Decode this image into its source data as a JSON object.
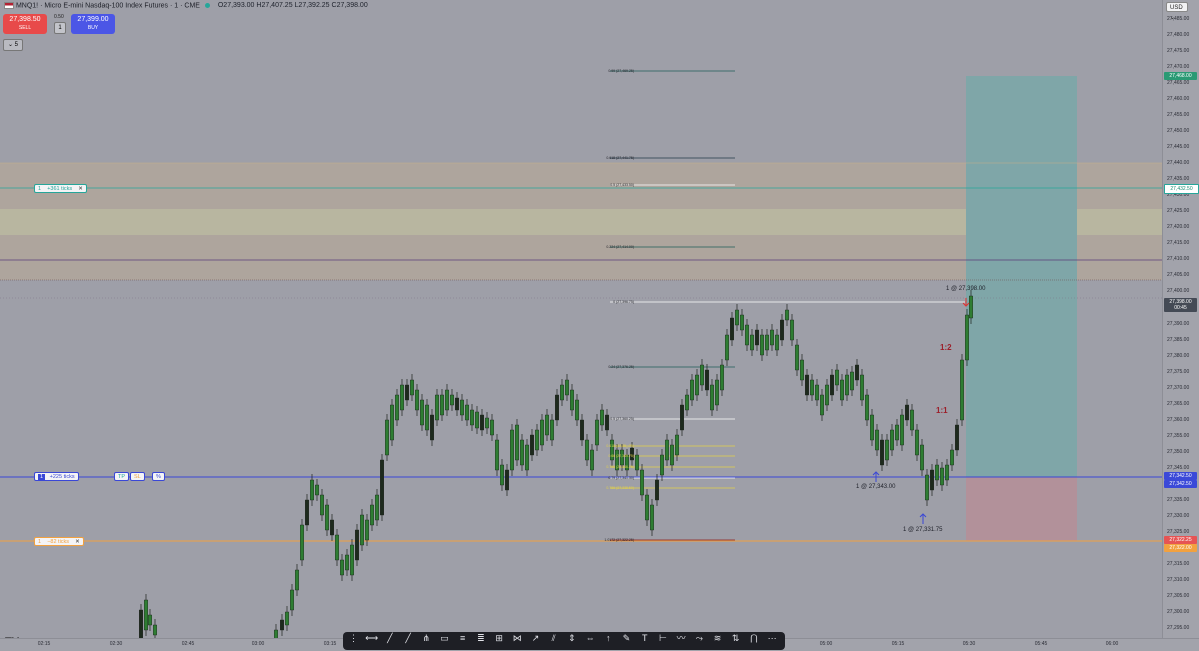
{
  "header": {
    "symbol": "MNQ1! · Micro E-mini Nasdaq-100 Index Futures · 1 · CME",
    "ohlc": "O27,393.00 H27,407.25 L27,392.25 C27,398.00",
    "sell_price": "27,398.50",
    "sell_label": "SELL",
    "spread": "0.50",
    "qty": "1",
    "buy_price": "27,399.00",
    "buy_label": "BUY",
    "indicators_badge": "5",
    "currency": "USD"
  },
  "price_axis": {
    "ticks": [
      "27,485.00",
      "27,480.00",
      "27,475.00",
      "27,470.00",
      "27,465.00",
      "27,460.00",
      "27,455.00",
      "27,450.00",
      "27,445.00",
      "27,440.00",
      "27,435.00",
      "27,430.00",
      "27,425.00",
      "27,420.00",
      "27,415.00",
      "27,410.00",
      "27,405.00",
      "27,400.00",
      "27,390.00",
      "27,385.00",
      "27,380.00",
      "27,375.00",
      "27,370.00",
      "27,365.00",
      "27,360.00",
      "27,355.00",
      "27,350.00",
      "27,345.00",
      "27,335.00",
      "27,330.00",
      "27,325.00",
      "27,315.00",
      "27,310.00",
      "27,305.00",
      "27,300.00",
      "27,295.00"
    ],
    "tags": [
      {
        "label": "27,468.00",
        "color": "#2a9a74"
      },
      {
        "label": "27,432.50",
        "color": "#ffffff",
        "text": "#1b8c73"
      },
      {
        "label": "27,398.00",
        "sub": "00:45",
        "color": "#444a55"
      },
      {
        "label": "27,342.50",
        "color": "#3b49d8"
      },
      {
        "label": "27,342.50",
        "color": "#e65454"
      },
      {
        "label": "27,322.25",
        "color": "#e65454"
      },
      {
        "label": "27,322.00",
        "color": "#f2a13f"
      }
    ]
  },
  "time_axis": [
    "02:15",
    "02:30",
    "02:45",
    "03:00",
    "03:15",
    "03:30",
    "03:45",
    "04:00",
    "04:15",
    "04:30",
    "04:45",
    "05:00",
    "05:15",
    "05:30",
    "05:45",
    "06:00"
  ],
  "fib_levels": [
    "0.99 (27,469.25)",
    "0.618 (27,441.75)",
    "0.5 (27,433.50)",
    "0.224 (27,414.00)",
    "0 (27,396.75)",
    "0.24 (27,376.25)",
    "0.5 (27,360.25)",
    "1.0172 (27,322.25)"
  ],
  "fib_small": [
    "0.618 (27,35_.75)",
    "0.66 (27,349.75)",
    "0.705 (27,346.75)",
    "0.79 (27,341.50)",
    "0.786 (27,338.50)"
  ],
  "orders": {
    "tp": {
      "qty": "1",
      "label": "+361 ticks",
      "close": "✕"
    },
    "entry": {
      "qty": "1",
      "label": "+225 ticks",
      "tp": "TP",
      "sl": "SL",
      "pct": "%"
    },
    "sl": {
      "qty": "1",
      "label": "−82 ticks",
      "close": "✕"
    }
  },
  "annotations": {
    "r2": "1:2",
    "r1": "1:1",
    "sell_mark": "1 @ 27,398.00",
    "buy_mark1": "1 @ 27,343.00",
    "buy_mark2": "1 @ 27,331.75"
  },
  "colors": {
    "background": "#9e9fa8",
    "tp_zone": "#7fa5a7",
    "sl_zone": "#b29099",
    "up_candle": "#2e7d32",
    "down_candle": "#1d2a1d",
    "entry_line": "#3a47d6",
    "sl_line": "#f2a13f",
    "tp_line": "#26a69a"
  },
  "toolbar_icons": [
    "grip-icon",
    "horizontal-line-icon",
    "trend-line-icon",
    "ray-icon",
    "pitchfork-icon",
    "rectangle-icon",
    "parallel-channel-icon",
    "fib-retracement-icon",
    "gann-icon",
    "pattern-icon",
    "forecast-icon",
    "long-position-icon",
    "price-range-icon",
    "date-range-icon",
    "arrow-icon",
    "brush-icon",
    "text-icon",
    "measure-icon",
    "zigzag-icon",
    "path-icon",
    "fib-channel-icon",
    "projection-icon",
    "magnet-icon",
    "more-icon"
  ]
}
